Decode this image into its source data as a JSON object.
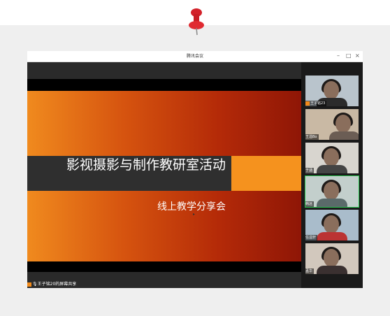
{
  "window": {
    "title": "腾讯会议",
    "controls": {
      "minimize": "–",
      "maximize": "□",
      "close": "×"
    }
  },
  "slide": {
    "title": "影视摄影与制作教研室活动",
    "subtitle": "线上教学分享会"
  },
  "share_label": "王子铭20的屏幕共享",
  "participants": [
    {
      "name": "王子铭23",
      "host": true
    },
    {
      "name": "王溢Bo",
      "host": false
    },
    {
      "name": "于涵",
      "host": false
    },
    {
      "name": "韩远",
      "host": false,
      "speaking": true
    },
    {
      "name": "任溢轩",
      "host": false
    },
    {
      "name": "孟华",
      "host": false
    }
  ],
  "icons": [
    "pushpin-icon",
    "host-icon",
    "mic-icon"
  ],
  "colors": {
    "accent_orange": "#f5921e",
    "speaking_border": "#27c24c"
  }
}
